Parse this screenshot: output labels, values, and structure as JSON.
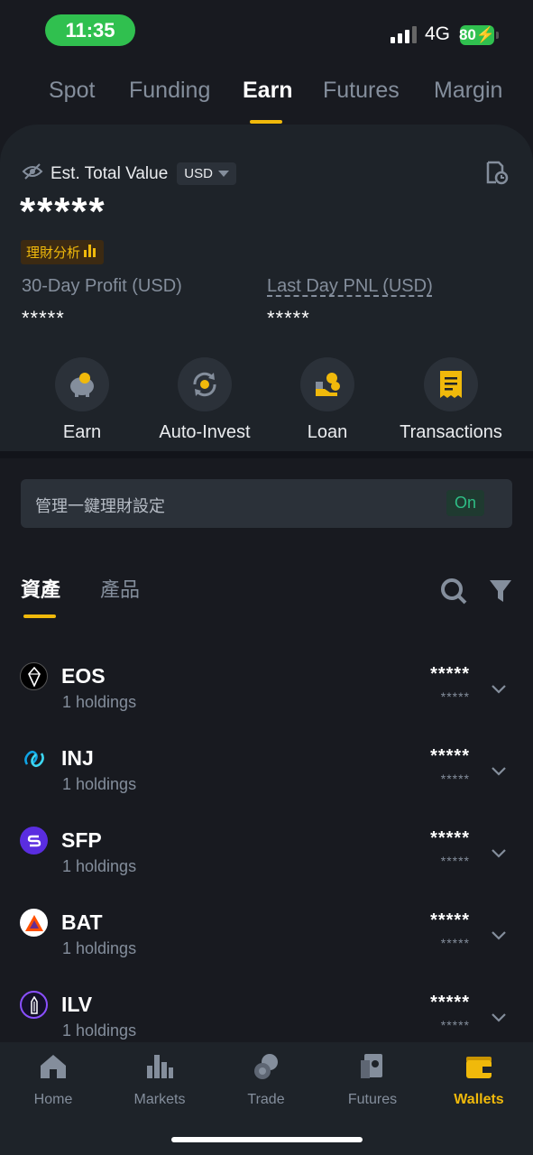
{
  "status_bar": {
    "time": "11:35",
    "network": "4G",
    "battery": "80"
  },
  "top_tabs": [
    {
      "label": "Spot"
    },
    {
      "label": "Funding"
    },
    {
      "label": "Earn"
    },
    {
      "label": "Futures"
    },
    {
      "label": "Margin"
    }
  ],
  "active_top_tab": "Earn",
  "summary": {
    "est_label": "Est. Total Value",
    "currency": "USD",
    "total_value": "*****",
    "analysis_badge": "理財分析",
    "profit_label": "30-Day Profit (USD)",
    "profit_value": "*****",
    "pnl_label": "Last Day PNL (USD)",
    "pnl_value": "*****"
  },
  "actions": [
    {
      "label": "Earn",
      "icon": "piggy-bank-icon"
    },
    {
      "label": "Auto-Invest",
      "icon": "auto-invest-icon"
    },
    {
      "label": "Loan",
      "icon": "loan-icon"
    },
    {
      "label": "Transactions",
      "icon": "receipt-icon"
    }
  ],
  "settings": {
    "label": "管理一鍵理財設定",
    "toggle": "On"
  },
  "sub_tabs": [
    {
      "label": "資產"
    },
    {
      "label": "產品"
    }
  ],
  "assets": [
    {
      "symbol": "EOS",
      "holdings": "1 holdings",
      "value": "*****",
      "sub_value": "*****"
    },
    {
      "symbol": "INJ",
      "holdings": "1 holdings",
      "value": "*****",
      "sub_value": "*****"
    },
    {
      "symbol": "SFP",
      "holdings": "1 holdings",
      "value": "*****",
      "sub_value": "*****"
    },
    {
      "symbol": "BAT",
      "holdings": "1 holdings",
      "value": "*****",
      "sub_value": "*****"
    },
    {
      "symbol": "ILV",
      "holdings": "1 holdings",
      "value": "*****",
      "sub_value": "*****"
    }
  ],
  "bottom_nav": [
    {
      "label": "Home"
    },
    {
      "label": "Markets"
    },
    {
      "label": "Trade"
    },
    {
      "label": "Futures"
    },
    {
      "label": "Wallets"
    }
  ],
  "active_bottom_nav": "Wallets",
  "colors": {
    "accent": "#f0b90b",
    "positive": "#2ebd85",
    "background": "#181a20",
    "card": "#1e2329"
  }
}
